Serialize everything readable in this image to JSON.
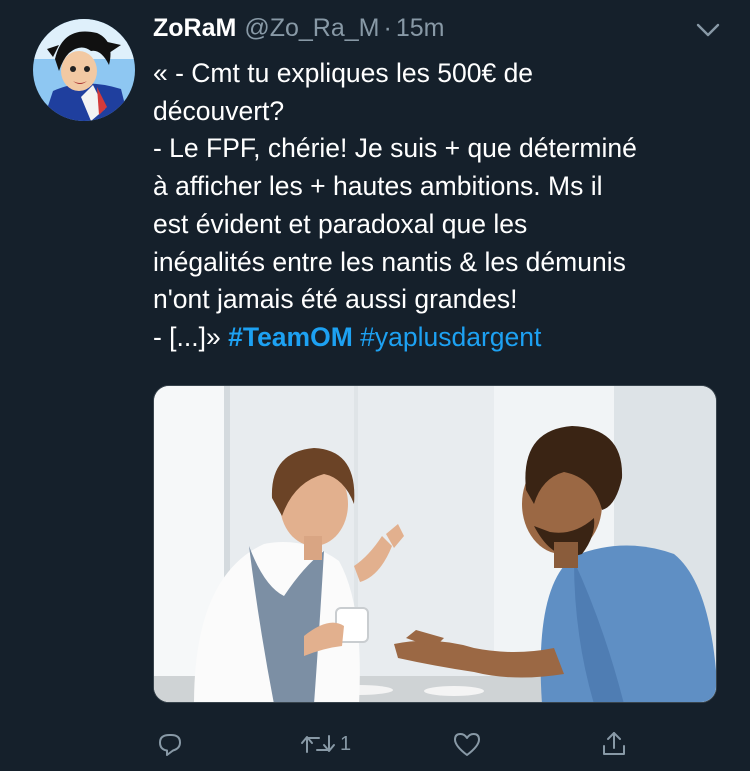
{
  "tweet": {
    "display_name": "ZoRaM",
    "handle": "@Zo_Ra_M",
    "separator": "·",
    "time": "15m",
    "lines": [
      "« - Cmt tu expliques les 500€ de",
      "découvert?",
      "- Le FPF, chérie! Je suis + que déterminé",
      "à afficher les + hautes ambitions. Ms il",
      "est évident et paradoxal que les",
      "inégalités entre les nantis & les démunis",
      "n'ont jamais été aussi grandes!"
    ],
    "last_line_prefix": "- [...]» ",
    "hashtag_1": "#TeamOM",
    "hashtag_2": "#yaplusdargent",
    "retweet_count": "1",
    "icons": {
      "menu": "chevron-down-icon",
      "reply": "reply-icon",
      "retweet": "retweet-icon",
      "like": "heart-icon",
      "share": "share-icon"
    }
  },
  "theme": {
    "background": "#15202b",
    "secondary_text": "#8899a6",
    "link": "#1da1f2"
  }
}
